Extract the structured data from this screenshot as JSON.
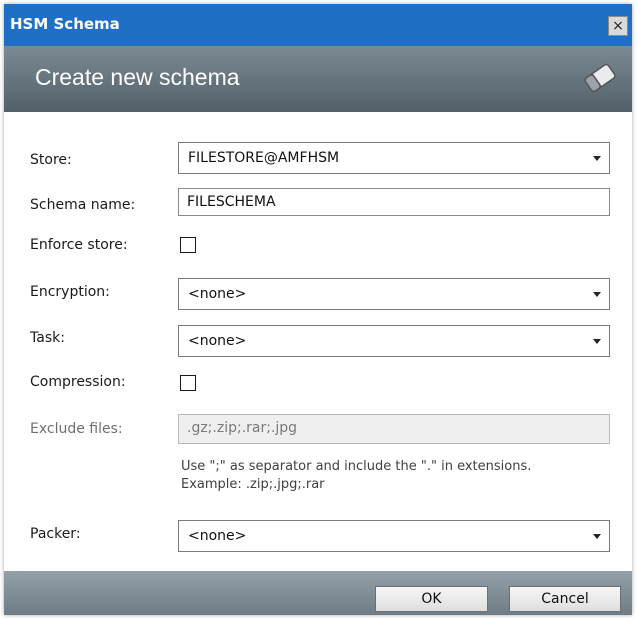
{
  "window": {
    "title": "HSM Schema",
    "close_symbol": "×"
  },
  "banner": {
    "heading": "Create new schema",
    "logo_icon": "eraser-icon"
  },
  "form": {
    "store": {
      "label": "Store:",
      "value": "FILESTORE@AMFHSM"
    },
    "schema_name": {
      "label": "Schema name:",
      "value": "FILESCHEMA"
    },
    "enforce_store": {
      "label": "Enforce store:",
      "checked": false
    },
    "encryption": {
      "label": "Encryption:",
      "value": "<none>"
    },
    "task": {
      "label": "Task:",
      "value": "<none>"
    },
    "compression": {
      "label": "Compression:",
      "checked": false
    },
    "exclude_files": {
      "label": "Exclude files:",
      "value": ".gz;.zip;.rar;.jpg",
      "hint_line1": "Use \";\" as separator and include the \".\" in extensions.",
      "hint_line2": "Example: .zip;.jpg;.rar"
    },
    "packer": {
      "label": "Packer:",
      "value": "<none>"
    }
  },
  "footer": {
    "ok_label": "OK",
    "cancel_label": "Cancel"
  },
  "colors": {
    "titlebar": "#1f6fc6",
    "banner": "#67747d",
    "footer": "#7f8b93"
  }
}
